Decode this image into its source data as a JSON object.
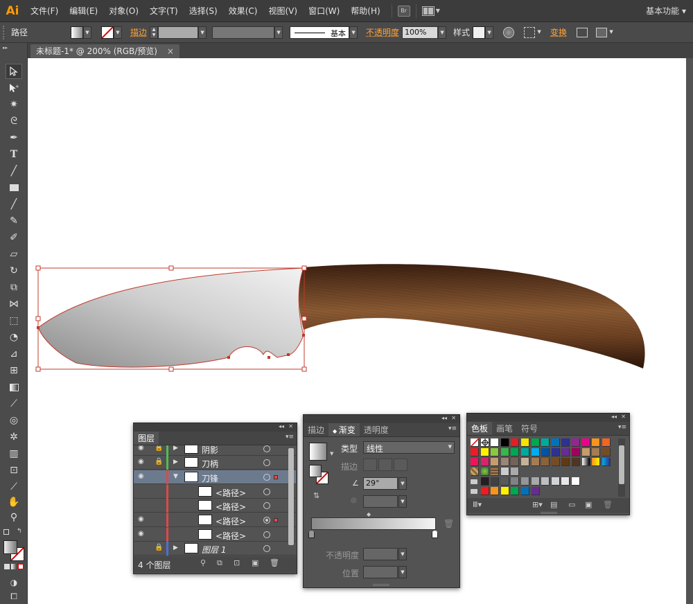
{
  "app": {
    "logo": "Ai",
    "workspace": "基本功能 ▾"
  },
  "menu": [
    "文件(F)",
    "编辑(E)",
    "对象(O)",
    "文字(T)",
    "选择(S)",
    "效果(C)",
    "视图(V)",
    "窗口(W)",
    "帮助(H)"
  ],
  "menu_icons": {
    "bridge": "Br",
    "arrange": "arrange-documents-icon"
  },
  "control": {
    "path_label": "路径",
    "stroke_label": "描边",
    "stroke_style": "基本",
    "opacity_label": "不透明度",
    "opacity_value": "100%",
    "style_label": "样式",
    "transform_label": "变换"
  },
  "tab": {
    "title": "未标题-1* @ 200% (RGB/预览)",
    "close": "×"
  },
  "colors": {
    "accent": "#ffa43a",
    "selection": "#c0392b",
    "ui_bg": "#535353"
  },
  "layers": {
    "tab": "图层",
    "rows": [
      {
        "name": "阴影",
        "bar": "#4fbf4f",
        "eye": true,
        "lock": true,
        "expand": "▶",
        "italic": false
      },
      {
        "name": "刀柄",
        "bar": "#4fbf4f",
        "eye": true,
        "lock": true,
        "expand": "▶",
        "italic": false
      },
      {
        "name": "刀锋",
        "bar": "#e04848",
        "eye": true,
        "lock": false,
        "expand": "▼",
        "italic": false
      },
      {
        "name": "<路径>",
        "bar": "#e04848",
        "eye": false,
        "lock": false,
        "expand": "",
        "italic": false
      },
      {
        "name": "<路径>",
        "bar": "#e04848",
        "eye": false,
        "lock": false,
        "expand": "",
        "italic": false
      },
      {
        "name": "<路径>",
        "bar": "#e04848",
        "eye": true,
        "lock": false,
        "expand": "",
        "italic": false
      },
      {
        "name": "<路径>",
        "bar": "#e04848",
        "eye": true,
        "lock": false,
        "expand": "",
        "italic": false
      },
      {
        "name": "图层 1",
        "bar": "#4a6fd8",
        "eye": false,
        "lock": true,
        "expand": "▶",
        "italic": true
      }
    ],
    "footer": "4 个图层"
  },
  "gradient": {
    "tabs": [
      "描边",
      "渐变",
      "透明度"
    ],
    "type_label": "类型",
    "type_value": "线性",
    "stroke_label": "描边",
    "angle_value": "29°",
    "opacity_label": "不透明度",
    "location_label": "位置"
  },
  "swatches": {
    "tabs": [
      "色板",
      "画笔",
      "符号"
    ]
  }
}
